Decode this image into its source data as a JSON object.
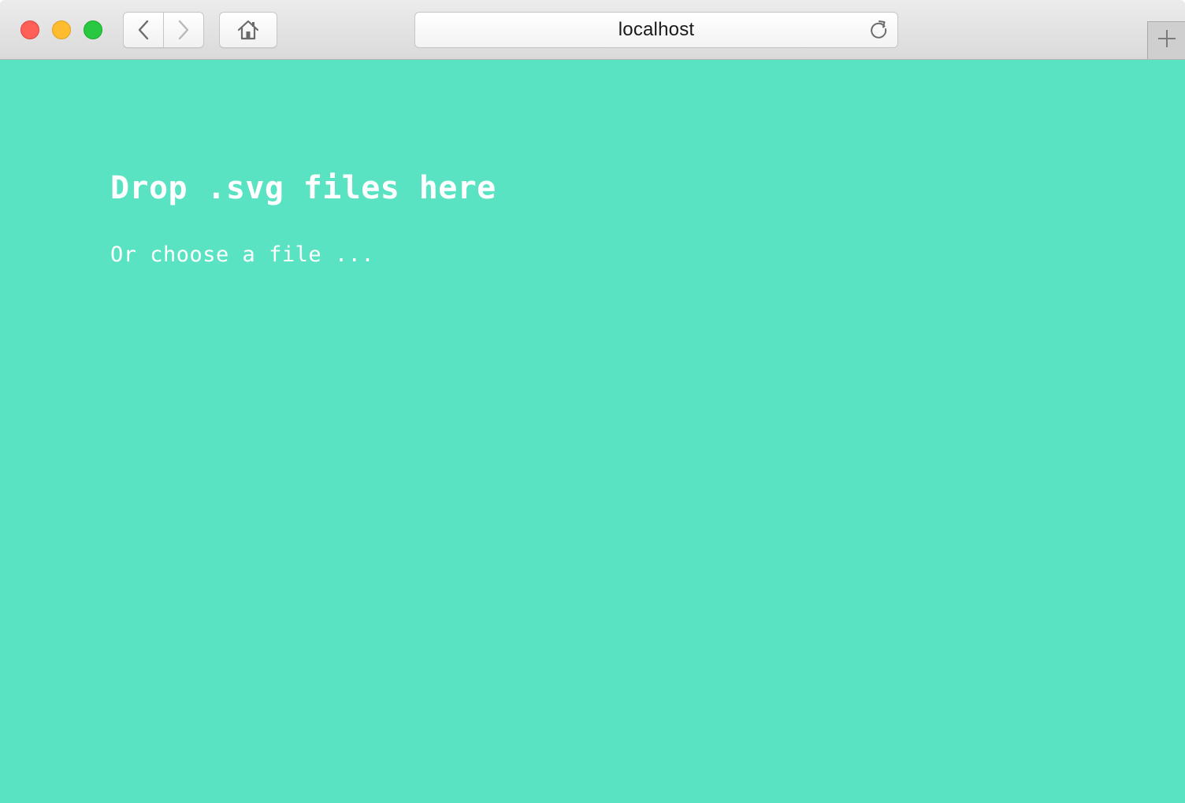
{
  "browser": {
    "address_bar": {
      "url": "localhost"
    },
    "icons": {
      "back": "chevron-left-icon",
      "forward": "chevron-right-icon",
      "home": "home-icon",
      "reload": "reload-icon",
      "new_tab": "plus-icon"
    },
    "colors": {
      "close": "#fe5f57",
      "minimize": "#febc2e",
      "maximize": "#28c840"
    }
  },
  "page": {
    "background_color": "#5ae3c2",
    "text_color": "#ffffff",
    "headline": "Drop .svg files here",
    "choose_file_link": "Or choose a file ..."
  }
}
